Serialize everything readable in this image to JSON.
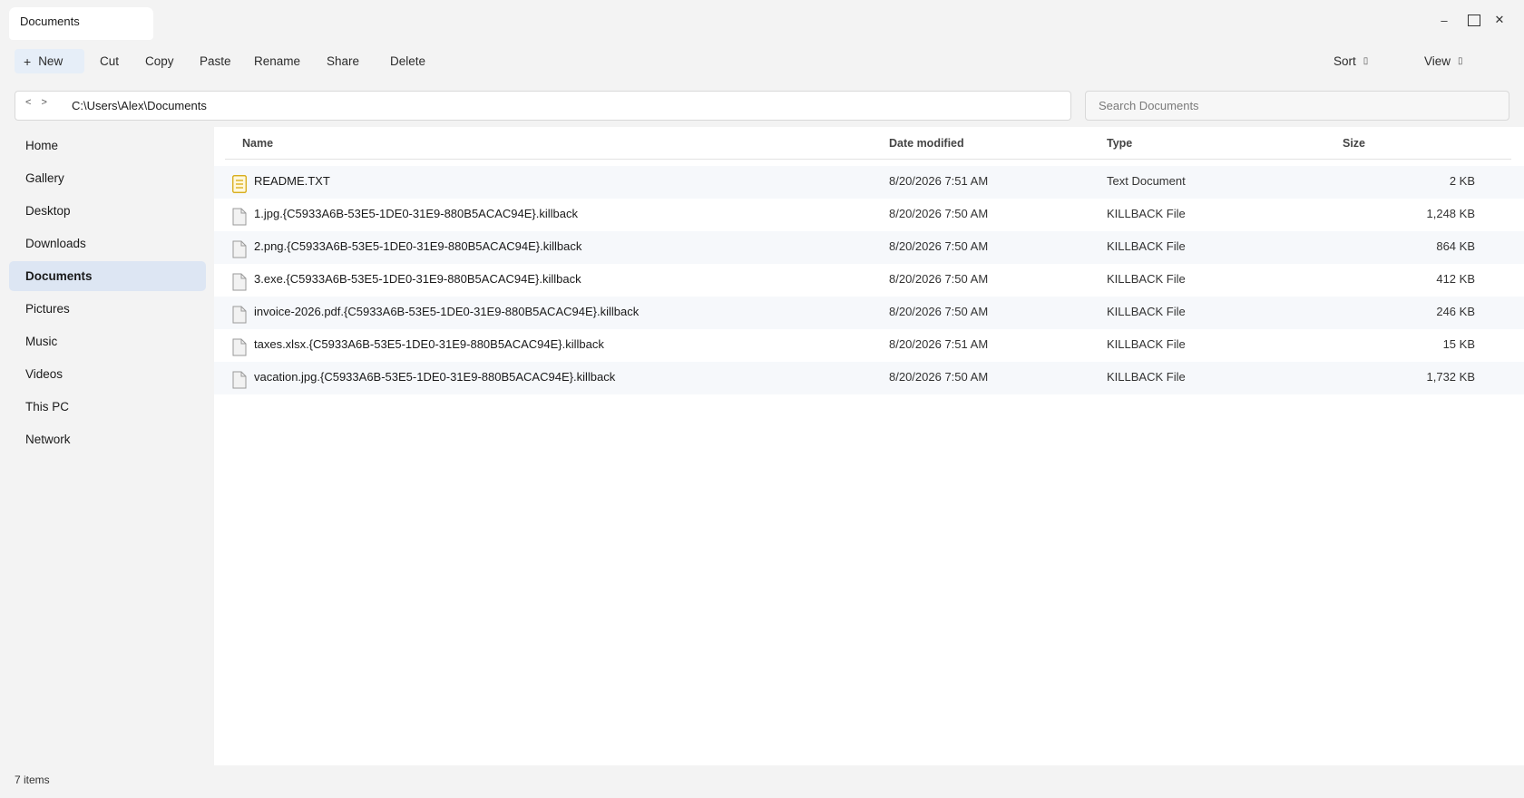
{
  "window": {
    "tab_title": "Documents",
    "controls": {
      "minimize": "–",
      "close": "✕"
    }
  },
  "toolbar": {
    "new_label": "New",
    "cut_label": "Cut",
    "copy_label": "Copy",
    "paste_label": "Paste",
    "rename_label": "Rename",
    "share_label": "Share",
    "delete_label": "Delete",
    "sort_label": "Sort",
    "view_label": "View"
  },
  "address": {
    "back_forward": "< >",
    "path": "C:\\Users\\Alex\\Documents"
  },
  "search": {
    "placeholder": "Search Documents"
  },
  "sidebar": {
    "items": [
      {
        "label": "Home"
      },
      {
        "label": "Gallery"
      },
      {
        "label": "Desktop"
      },
      {
        "label": "Downloads"
      },
      {
        "label": "Documents"
      },
      {
        "label": "Pictures"
      },
      {
        "label": "Music"
      },
      {
        "label": "Videos"
      },
      {
        "label": "This PC"
      },
      {
        "label": "Network"
      }
    ],
    "active": "Documents"
  },
  "table": {
    "columns": {
      "name": "Name",
      "date": "Date modified",
      "type": "Type",
      "size": "Size"
    },
    "rows": [
      {
        "name": "README.TXT",
        "date": "8/20/2026 7:51 AM",
        "type": "Text Document",
        "size": "2 KB",
        "icon": "text-file-icon"
      },
      {
        "name": "1.jpg.{C5933A6B-53E5-1DE0-31E9-880B5ACAC94E}.killback",
        "date": "8/20/2026 7:50 AM",
        "type": "KILLBACK File",
        "size": "1,248 KB",
        "icon": "file-icon"
      },
      {
        "name": "2.png.{C5933A6B-53E5-1DE0-31E9-880B5ACAC94E}.killback",
        "date": "8/20/2026 7:50 AM",
        "type": "KILLBACK File",
        "size": "864 KB",
        "icon": "file-icon"
      },
      {
        "name": "3.exe.{C5933A6B-53E5-1DE0-31E9-880B5ACAC94E}.killback",
        "date": "8/20/2026 7:50 AM",
        "type": "KILLBACK File",
        "size": "412 KB",
        "icon": "file-icon"
      },
      {
        "name": "invoice-2026.pdf.{C5933A6B-53E5-1DE0-31E9-880B5ACAC94E}.killback",
        "date": "8/20/2026 7:50 AM",
        "type": "KILLBACK File",
        "size": "246 KB",
        "icon": "file-icon"
      },
      {
        "name": "taxes.xlsx.{C5933A6B-53E5-1DE0-31E9-880B5ACAC94E}.killback",
        "date": "8/20/2026 7:51 AM",
        "type": "KILLBACK File",
        "size": "15 KB",
        "icon": "file-icon"
      },
      {
        "name": "vacation.jpg.{C5933A6B-53E5-1DE0-31E9-880B5ACAC94E}.killback",
        "date": "8/20/2026 7:50 AM",
        "type": "KILLBACK File",
        "size": "1,732 KB",
        "icon": "file-icon"
      }
    ]
  },
  "status": {
    "item_count": "7 items"
  },
  "colors": {
    "accent_selected": "#dde6f3",
    "new_button_bg": "#e6eef8",
    "text_icon_accent": "#d4a400"
  }
}
